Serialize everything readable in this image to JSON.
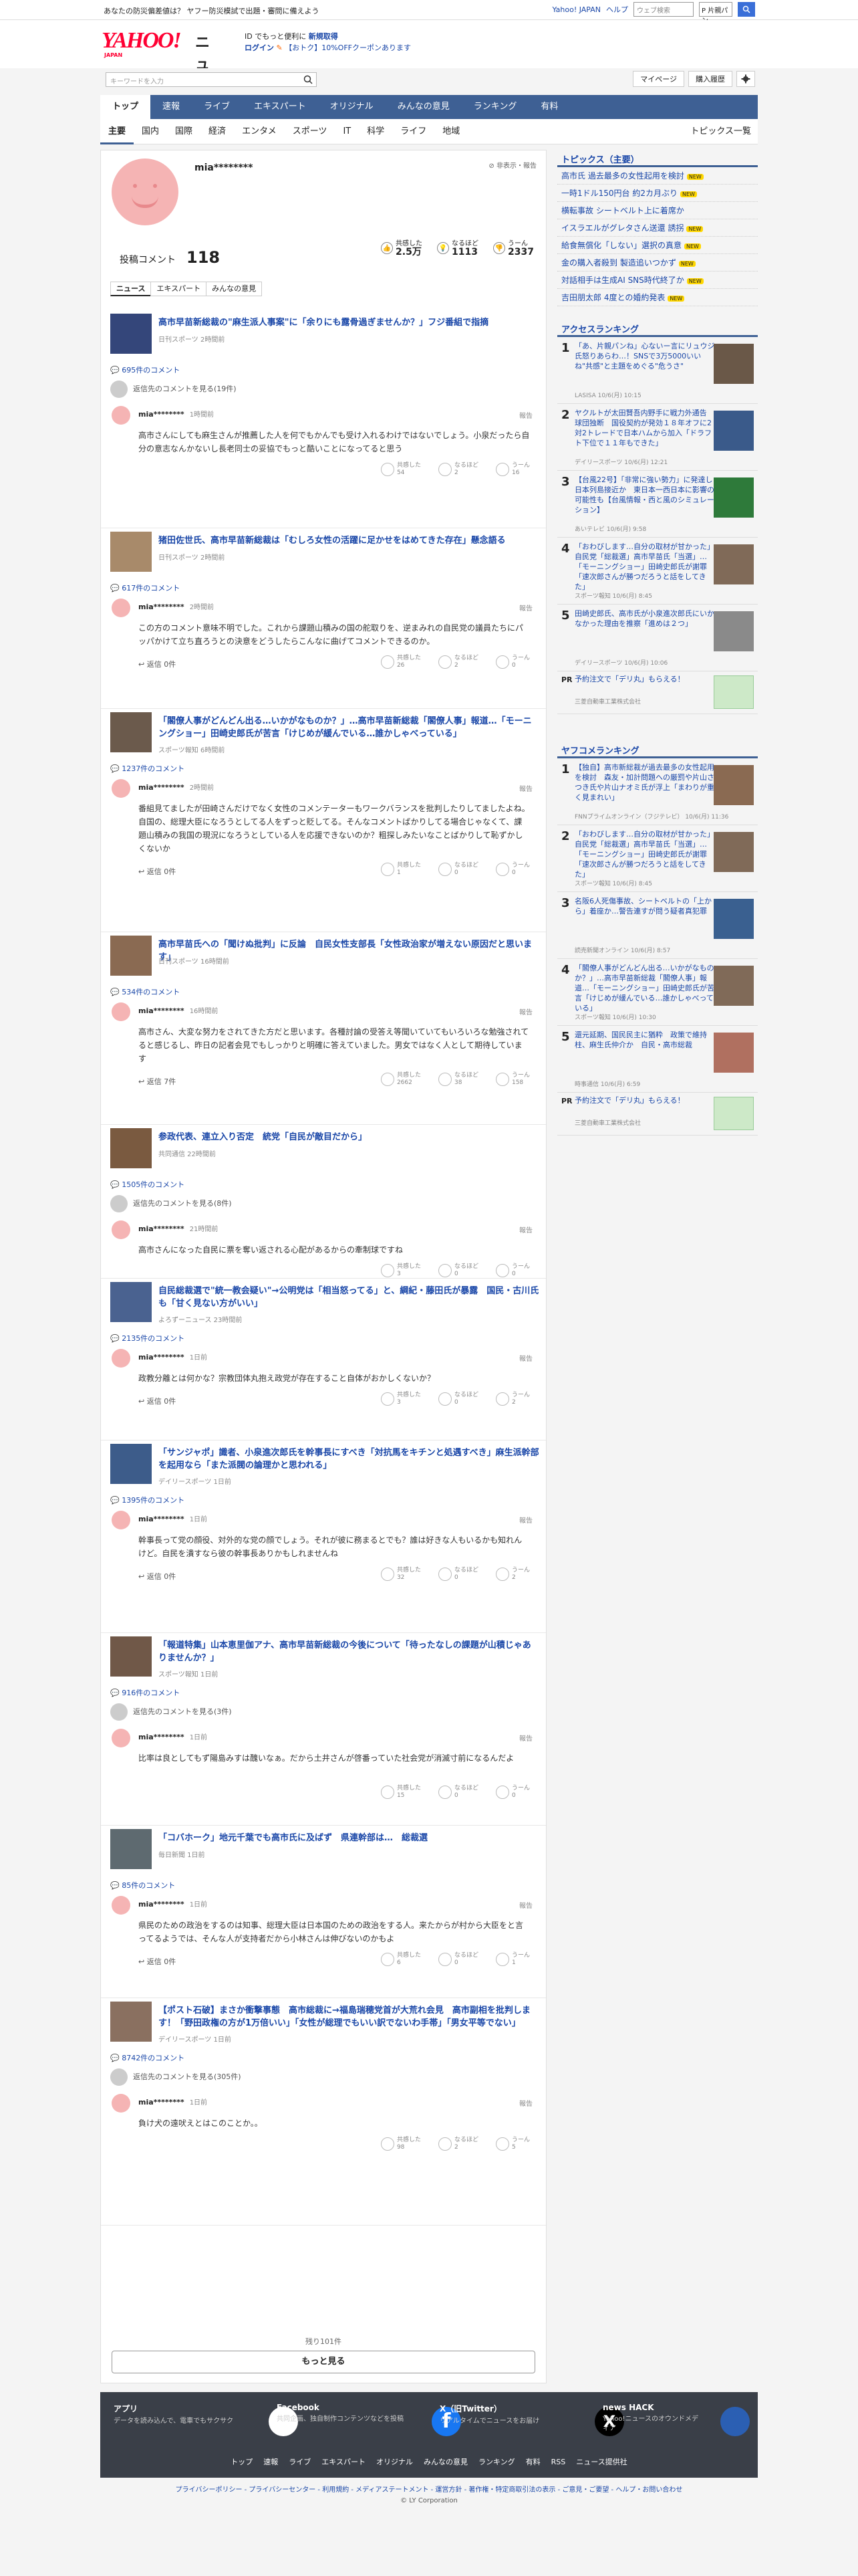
{
  "topbar": {
    "left_links": "あなたの防災偏差値は？ ヤフー防災模試で出題・審問に備えよう",
    "yahoo_japan": "Yahoo! JAPAN",
    "help": "ヘルプ",
    "search_placeholder": "ウェブ検索",
    "select_value": "P 片親パン"
  },
  "header": {
    "logo_text": "YAHOO!",
    "logo_sub": "JAPAN",
    "logo_news": "ニュース",
    "promo_line1": "ID でもっと便利に",
    "promo_register": "新規取得",
    "promo_login": "ログイン",
    "promo_coupon": "【おトク】10%OFFクーポンあります",
    "search_placeholder": "キーワードを入力",
    "mypage": "マイページ",
    "history": "購入履歴"
  },
  "mainnav": [
    "トップ",
    "速報",
    "ライブ",
    "エキスパート",
    "オリジナル",
    "みんなの意見",
    "ランキング",
    "有料"
  ],
  "subnav": [
    "主要",
    "国内",
    "国際",
    "経済",
    "エンタメ",
    "スポーツ",
    "IT",
    "科学",
    "ライフ",
    "地域"
  ],
  "subnav_topics": "トピックス一覧",
  "profile": {
    "name": "mia********",
    "notice": "非表示・報告",
    "comments_label": "投稿コメント",
    "comments_count": "118",
    "stats": [
      {
        "label": "共感した",
        "value": "2.5万"
      },
      {
        "label": "なるほど",
        "value": "1113"
      },
      {
        "label": "うーん",
        "value": "2337"
      }
    ],
    "tabs": [
      "ニュース",
      "エキスパート",
      "みんなの意見"
    ]
  },
  "articles": [
    {
      "title": "高市早苗新総裁の\"麻生派人事案\"に「余りにも露骨過ぎませんか？」フジ番組で指摘",
      "source": "日刊スポーツ 2時間前",
      "count": "695件のコメント",
      "reply_other": "返信先のコメントを見る(19件)",
      "user": "mia********",
      "time": "1時間前",
      "body": "高市さんにしても麻生さんが推薦した人を何でもかんでも受け入れるわけではないでしょう。小泉だったら自分の意志なんかないし長老同士の妥協でもっと酷いことになってると思う",
      "votes": [
        "54",
        "2",
        "16"
      ],
      "replies": ""
    },
    {
      "title": "猪田佐世氏、高市早苗新総裁は「むしろ女性の活躍に足かせをはめてきた存在」懸念語る",
      "source": "日刊スポーツ 2時間前",
      "count": "617件のコメント",
      "reply_other": "",
      "user": "mia********",
      "time": "2時間前",
      "body": "この方のコメント意味不明でした。これから課題山積みの国の舵取りを、逆まみれの自民党の議員たちにパッパかけて立ち直ろうとの決意をどうしたらこんなに曲げてコメントできるのか。",
      "votes": [
        "26",
        "2",
        "0"
      ],
      "replies": "返信 0件"
    },
    {
      "title": "「閣僚人事がどんどん出る…いかがなものか？」…高市早苗新総裁「閣僚人事」報道…「モーニングショー」田崎史郎氏が苦言「けじめが緩んでいる…誰かしゃべっている」",
      "source": "スポーツ報知 6時間前",
      "count": "1237件のコメント",
      "reply_other": "",
      "user": "mia********",
      "time": "2時間前",
      "body": "番組見てましたが田崎さんだけでなく女性のコメンテーターもワークバランスを批判したりしてましたよね。自国の、総理大臣になろうとしてる人をずっと貶してる。そんなコメントばかりしてる場合じゃなくて、課題山積みの我国の現況になろうとしている人を応援できないのか？粗探しみたいなことばかりして恥ずかしくないか",
      "votes": [
        "1",
        "0",
        "0"
      ],
      "replies": "返信 0件"
    },
    {
      "title": "高市早苗氏への「聞けぬ批判」に反論　自民女性支部長「女性政治家が増えない原因だと思います」",
      "source": "日刊スポーツ 16時間前",
      "count": "534件のコメント",
      "reply_other": "",
      "user": "mia********",
      "time": "16時間前",
      "body": "高市さん、大変な努力をされてきた方だと思います。各種討論の受答え等聞いていてもいろいろな勉強されてると感じるし、昨日の記者会見でもしっかりと明確に答えていました。男女ではなく人として期待しています",
      "votes": [
        "2662",
        "38",
        "158"
      ],
      "replies": "返信 7件"
    },
    {
      "title": "参政代表、連立入り否定　統党「自民が敵目だから」",
      "source": "共同通信 22時間前",
      "count": "1505件のコメント",
      "reply_other": "返信先のコメントを見る(8件)",
      "user": "mia********",
      "time": "21時間前",
      "body": "高市さんになった自民に票を奪い返される心配があるからの牽制球ですね",
      "votes": [
        "3",
        "0",
        "0"
      ],
      "replies": ""
    },
    {
      "title": "自民総裁選で\"統一教会疑い\"→公明党は「相当怒ってる」と、綱紀・藤田氏が暴露　国民・古川氏も「甘く見ない方がいい」",
      "source": "よろずーニュース 23時間前",
      "count": "2135件のコメント",
      "reply_other": "",
      "user": "mia********",
      "time": "1日前",
      "body": "政教分離とは何かな？宗教団体丸抱え政党が存在すること自体がおかしくないか？",
      "votes": [
        "3",
        "0",
        "2"
      ],
      "replies": "返信 0件"
    },
    {
      "title": "「サンジャポ」識者、小泉進次郎氏を幹事長にすべき「対抗馬をキチンと処遇すべき」麻生派幹部を起用なら「また派閥の論理かと思われる」",
      "source": "デイリースポーツ 1日前",
      "count": "1395件のコメント",
      "reply_other": "",
      "user": "mia********",
      "time": "1日前",
      "body": "幹事長って党の顔役、対外的な党の顔でしょう。それが彼に務まるとでも？誰は好きな人もいるかも知れんけど。自民を潰すなら彼の幹事長ありかもしれませんね",
      "votes": [
        "32",
        "0",
        "2"
      ],
      "replies": "返信 0件"
    },
    {
      "title": "「報道特集」山本恵里伽アナ、高市早苗新総裁の今後について「待ったなしの課題が山積じゃありませんか？」",
      "source": "スポーツ報知 1日前",
      "count": "916件のコメント",
      "reply_other": "返信先のコメントを見る(3件)",
      "user": "mia********",
      "time": "1日前",
      "body": "比率は良としてもず陽島みすは醜いなぁ。だから土井さんが啓番っていた社会党が消滅寸前になるんだよ",
      "votes": [
        "15",
        "0",
        "0"
      ],
      "replies": ""
    },
    {
      "title": "「コバホーク」地元千葉でも高市氏に及ばず　県連幹部は…　総裁選",
      "source": "毎日新聞 1日前",
      "count": "85件のコメント",
      "reply_other": "",
      "user": "mia********",
      "time": "1日前",
      "body": "県民のための政治をするのは知事、総理大臣は日本国のための政治をする人。来たからが村から大臣をと言ってるようでは、そんな人が支持者だから小林さんは伸びないのかもよ",
      "votes": [
        "6",
        "0",
        "1"
      ],
      "replies": "返信 0件"
    },
    {
      "title": "【ポスト石破】まさか衝撃事態　高市総裁に→福島瑞穂党首が大荒れ会見　高市副相を批判します！「野田政権の方が1万倍いい」「女性が総理でもいい訳でないわ手帯」「男女平等でない」",
      "source": "デイリースポーツ 1日前",
      "count": "8742件のコメント",
      "reply_other": "返信先のコメントを見る(305件)",
      "user": "mia********",
      "time": "1日前",
      "body": "負け犬の遠吠えとはこのことか。。",
      "votes": [
        "98",
        "2",
        "5"
      ],
      "replies": ""
    }
  ],
  "more_count": "残り101件",
  "more_button": "もっと見る",
  "vote_labels": [
    "共感した",
    "なるほど",
    "うーん"
  ],
  "report_label": "報告",
  "topics": {
    "title": "トピックス（主要）",
    "items": [
      {
        "t": "高市氏 過去最多の女性起用を検討",
        "badge": "new"
      },
      {
        "t": "一時1ドル150円台 約2カ月ぶり",
        "badge": "new"
      },
      {
        "t": "横転事故 シートベルト上に着席か",
        "badge": ""
      },
      {
        "t": "イスラエルがグレタさん送還 誘拐",
        "badge": "new"
      },
      {
        "t": "給食無償化「しない」選択の真意",
        "badge": "new"
      },
      {
        "t": "金の購入者殺到 製造追いつかず",
        "badge": "new"
      },
      {
        "t": "対話相手は生成AI SNS時代終了か",
        "badge": "new"
      },
      {
        "t": "吉田朋太郎 4度との婚約発表",
        "badge": "new"
      }
    ]
  },
  "access": {
    "title": "アクセスランキング",
    "items": [
      {
        "n": "1",
        "t": "「あ、片親パンね」心ないー言にリュウジ氏怒りあらわ…！SNSで3万5000いいね\"共感\"と主題をめぐる\"危うさ\"",
        "s": "LASISA 10/6(月) 10:15"
      },
      {
        "n": "2",
        "t": "ヤクルトが太田賢吾内野手に戦力外通告　球団独断　国役契約が発効１８年オフに2対2トレードで日本ハムから加入「ドラフト下位で１１年もできた」",
        "s": "デイリースポーツ 10/6(月) 12:21"
      },
      {
        "n": "3",
        "t": "【台風22号】「非常に強い勢力」に発達し日本列島接近か　東日本一西日本に影響の可能性も【台風情報・西と風のシミュレーション】",
        "s": "あいテレビ 10/6(月) 9:58"
      },
      {
        "n": "4",
        "t": "「おわびします…自分の取材が甘かった」自民党「総裁選」高市早苗氏「当選」…「モーニングショー」田崎史郎氏が謝罪「速次郎さんが勝つだろうと話をしてきた」",
        "s": "スポーツ報知 10/6(月) 8:45"
      },
      {
        "n": "5",
        "t": "田崎史郎氏、高市氏が小泉進次郎氏にいかなかった理由を推察「進めは２つ」",
        "s": "デイリースポーツ 10/6(月) 10:06"
      }
    ],
    "ad": {
      "pr": "PR",
      "t": "予約注文で「デリ丸」もらえる！",
      "s": "三菱自動車工業株式会社"
    }
  },
  "yafuko": {
    "title": "ヤフコメランキング",
    "items": [
      {
        "n": "1",
        "t": "【独自】高市新総裁が過去最多の女性起用を検討　森友・加計問題への厳罰や片山さつき氏や片山ナオミ氏が浮上「まわりが重く見まれい」",
        "s": "FNNプライムオンライン（フジテレビ） 10/6(月) 11:36"
      },
      {
        "n": "2",
        "t": "「おわびします…自分の取材が甘かった」自民党「総裁選」高市早苗氏「当選」…「モーニングショー」田崎史郎氏が謝罪「速次郎さんが勝つだろうと話をしてきた」",
        "s": "スポーツ報知 10/6(月) 8:45"
      },
      {
        "n": "3",
        "t": "名阪6人死傷事故、シートベルトの「上から」着座か…警告連すが問う疑者真犯罪",
        "s": "読売新聞オンライン 10/6(月) 8:57"
      },
      {
        "n": "4",
        "t": "「閣僚人事がどんどん出る…いかがなものか？」…高市早苗新総裁「閣僚人事」報道…「モーニングショー」田崎史郎氏が苦言「けじめが緩んでいる…誰かしゃべっている」",
        "s": "スポーツ報知 10/6(月) 10:30"
      },
      {
        "n": "5",
        "t": "還元延期、国民民主に猶粋　政策で維持柱、麻生氏仲介か　自民・高市総裁",
        "s": "時事通信 10/6(月) 6:59"
      }
    ],
    "ad": {
      "pr": "PR",
      "t": "予約注文で「デリ丸」もらえる！",
      "s": "三菱自動車工業株式会社"
    }
  },
  "footer": {
    "cols": [
      {
        "t": "アプリ",
        "d": "データを読み込んで、電車でもサクサク"
      },
      {
        "t": "Facebook",
        "d": "共同企画、独自制作コンテンツなどを投稿"
      },
      {
        "t": "X（旧Twitter）",
        "d": "リアルタイムでニュースをお届け"
      },
      {
        "t": "news HACK",
        "d": "Yahoo!ニュースのオウンドメディア"
      }
    ],
    "links": [
      "トップ",
      "速報",
      "ライブ",
      "エキスパート",
      "オリジナル",
      "みんなの意見",
      "ランキング",
      "有料",
      "RSS",
      "ニュース提供社"
    ],
    "legal": "プライバシーポリシー - プライバシーセンター - 利用規約 - メディアステートメント - 運営方針 - 著作権・特定商取引法の表示 - ご意見・ご要望 - ヘルプ・お問い合わせ",
    "copyright": "© LY Corporation"
  },
  "colors": {
    "nav": "#3e6094",
    "link": "#1a47a8",
    "brand": "#ff0033"
  }
}
